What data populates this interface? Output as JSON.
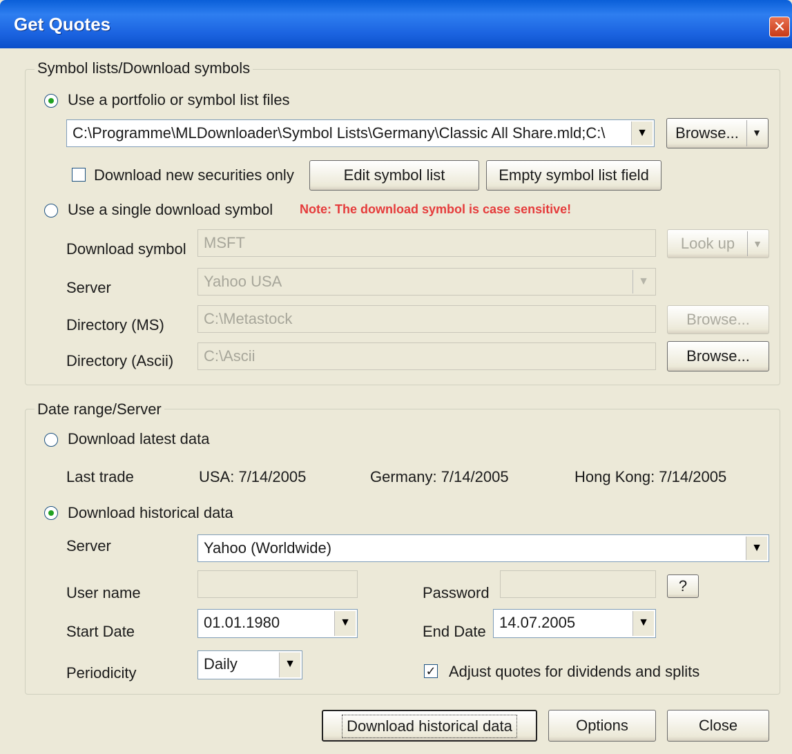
{
  "window": {
    "title": "Get Quotes",
    "close_glyph": "✕"
  },
  "symbols_group": {
    "legend": "Symbol lists/Download symbols",
    "use_portfolio_label": "Use a portfolio or symbol list files",
    "portfolio_path": "C:\\Programme\\MLDownloader\\Symbol Lists\\Germany\\Classic All Share.mld;C:\\",
    "browse_label": "Browse...",
    "download_new_only_label": "Download new securities only",
    "edit_symbol_list_label": "Edit symbol list",
    "empty_symbol_list_label": "Empty symbol list field",
    "use_single_label": "Use a single download symbol",
    "note": "Note: The download symbol is case sensitive!",
    "download_symbol_label": "Download symbol",
    "download_symbol_value": "MSFT",
    "lookup_label": "Look up",
    "server_label": "Server",
    "server_value": "Yahoo USA",
    "dir_ms_label": "Directory (MS)",
    "dir_ms_value": "C:\\Metastock",
    "browse_ms_label": "Browse...",
    "dir_ascii_label": "Directory (Ascii)",
    "dir_ascii_value": "C:\\Ascii",
    "browse_ascii_label": "Browse..."
  },
  "date_group": {
    "legend": "Date range/Server",
    "latest_label": "Download latest data",
    "last_trade_label": "Last trade",
    "usa": "USA: 7/14/2005",
    "germany": "Germany: 7/14/2005",
    "hongkong": "Hong Kong: 7/14/2005",
    "historical_label": "Download historical data",
    "server_label": "Server",
    "server_value": "Yahoo (Worldwide)",
    "user_name_label": "User name",
    "password_label": "Password",
    "help_label": "?",
    "start_date_label": "Start Date",
    "start_date_value": "01.01.1980",
    "end_date_label": "End Date",
    "end_date_value": "14.07.2005",
    "periodicity_label": "Periodicity",
    "periodicity_value": "Daily",
    "adjust_label": "Adjust quotes for dividends and splits"
  },
  "footer": {
    "download_label": "Download historical data",
    "options_label": "Options",
    "close_label": "Close"
  },
  "state": {
    "use_portfolio_selected": true,
    "single_symbol_selected": false,
    "latest_selected": false,
    "historical_selected": true,
    "download_new_only_checked": false,
    "adjust_checked": true
  }
}
